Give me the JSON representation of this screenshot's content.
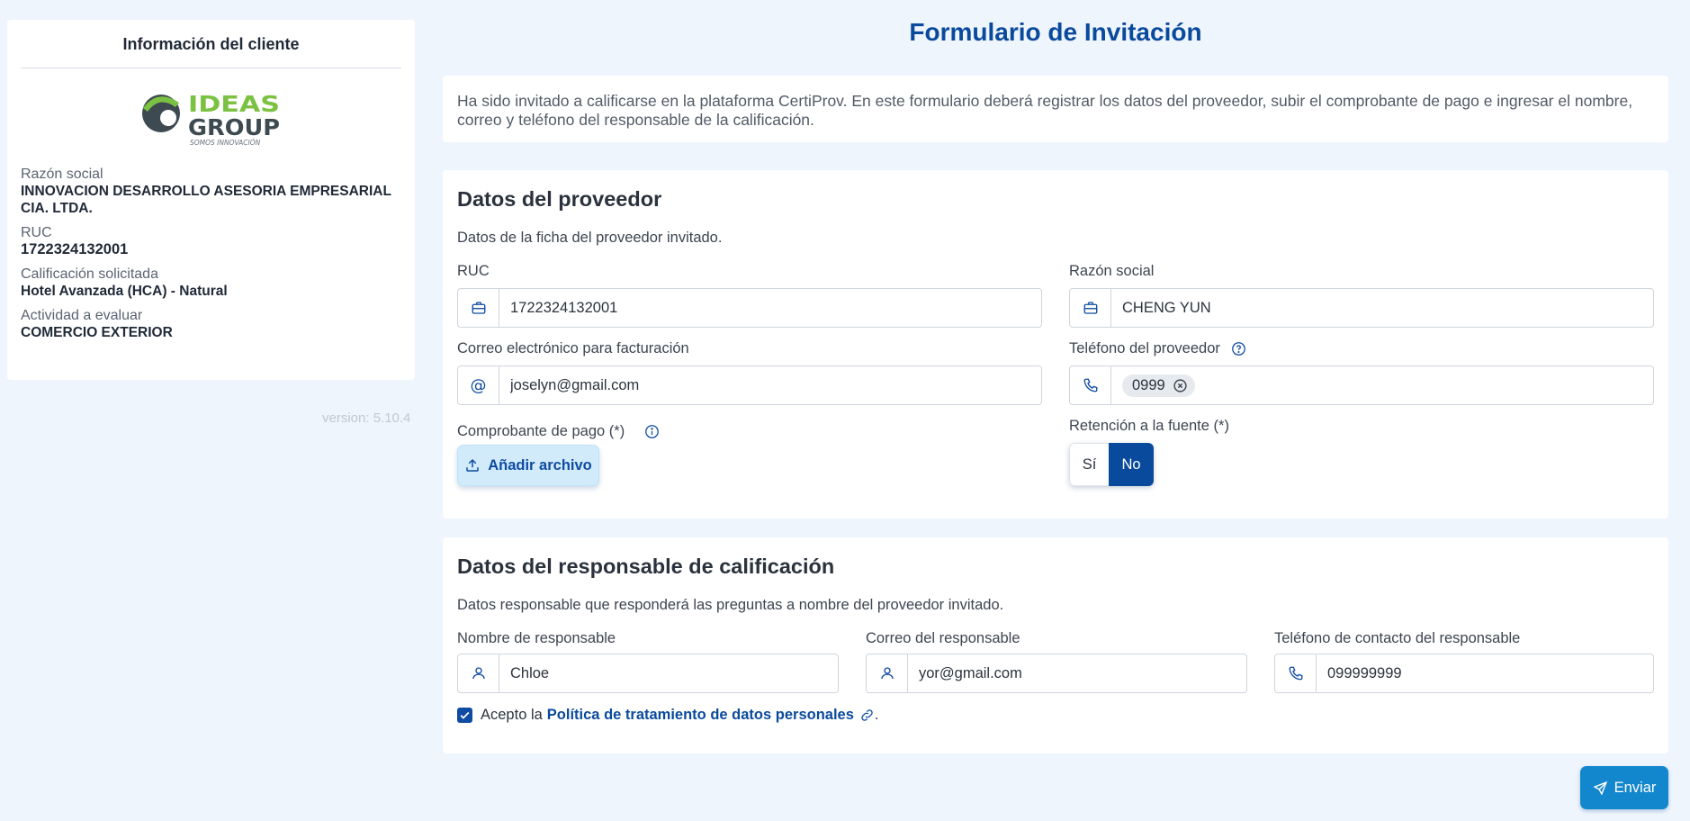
{
  "client_card": {
    "title": "Información del cliente",
    "logo": {
      "top_text": "IDEAS",
      "bottom_text": "GROUP",
      "tagline": "SOMOS INNOVACIÓN",
      "colors": {
        "green": "#7cc242",
        "dark": "#3d4a52"
      }
    },
    "fields": [
      {
        "label": "Razón social",
        "value": "INNOVACION DESARROLLO ASESORIA EMPRESARIAL CIA. LTDA."
      },
      {
        "label": "RUC",
        "value": "1722324132001"
      },
      {
        "label": "Calificación solicitada",
        "value": "Hotel Avanzada (HCA) - Natural"
      },
      {
        "label": "Actividad a evaluar",
        "value": "COMERCIO EXTERIOR"
      }
    ]
  },
  "version": "version: 5.10.4",
  "page_title": "Formulario de Invitación",
  "intro_text": "Ha sido invitado a calificarse en la plataforma CertiProv. En este formulario deberá registrar los datos del proveedor, subir el comprobante de pago e ingresar el nombre, correo y teléfono del responsable de la calificación.",
  "provider_section": {
    "title": "Datos del proveedor",
    "description": "Datos de la ficha del proveedor invitado.",
    "ruc": {
      "label": "RUC",
      "value": "1722324132001",
      "icon": "briefcase-icon"
    },
    "razon_social": {
      "label": "Razón social",
      "value": "CHENG YUN",
      "icon": "briefcase-icon"
    },
    "email": {
      "label": "Correo electrónico para facturación",
      "value": "joselyn@gmail.com",
      "icon": "at-icon"
    },
    "phone": {
      "label": "Teléfono del proveedor",
      "chip": "0999",
      "icon": "phone-icon"
    },
    "payment_proof": {
      "label": "Comprobante de pago (*)",
      "button": "Añadir archivo"
    },
    "retention": {
      "label": "Retención a la fuente (*)",
      "yes": "Sí",
      "no": "No",
      "selected": "No"
    }
  },
  "responsible_section": {
    "title": "Datos del responsable de calificación",
    "description": "Datos responsable que responderá las preguntas a nombre del proveedor invitado.",
    "name": {
      "label": "Nombre de responsable",
      "value": "Chloe",
      "icon": "user-icon"
    },
    "email": {
      "label": "Correo del responsable",
      "value": "yor@gmail.com",
      "icon": "user-icon"
    },
    "phone": {
      "label": "Teléfono de contacto del responsable",
      "value": "099999999",
      "icon": "phone-icon"
    },
    "consent": {
      "prefix": "Acepto la",
      "link": "Política de tratamiento de datos personales",
      "suffix": ".",
      "checked": true
    }
  },
  "send_button": "Enviar",
  "colors": {
    "primary": "#0a4a9c",
    "accent": "#1387cd",
    "background": "#eff5fd"
  }
}
